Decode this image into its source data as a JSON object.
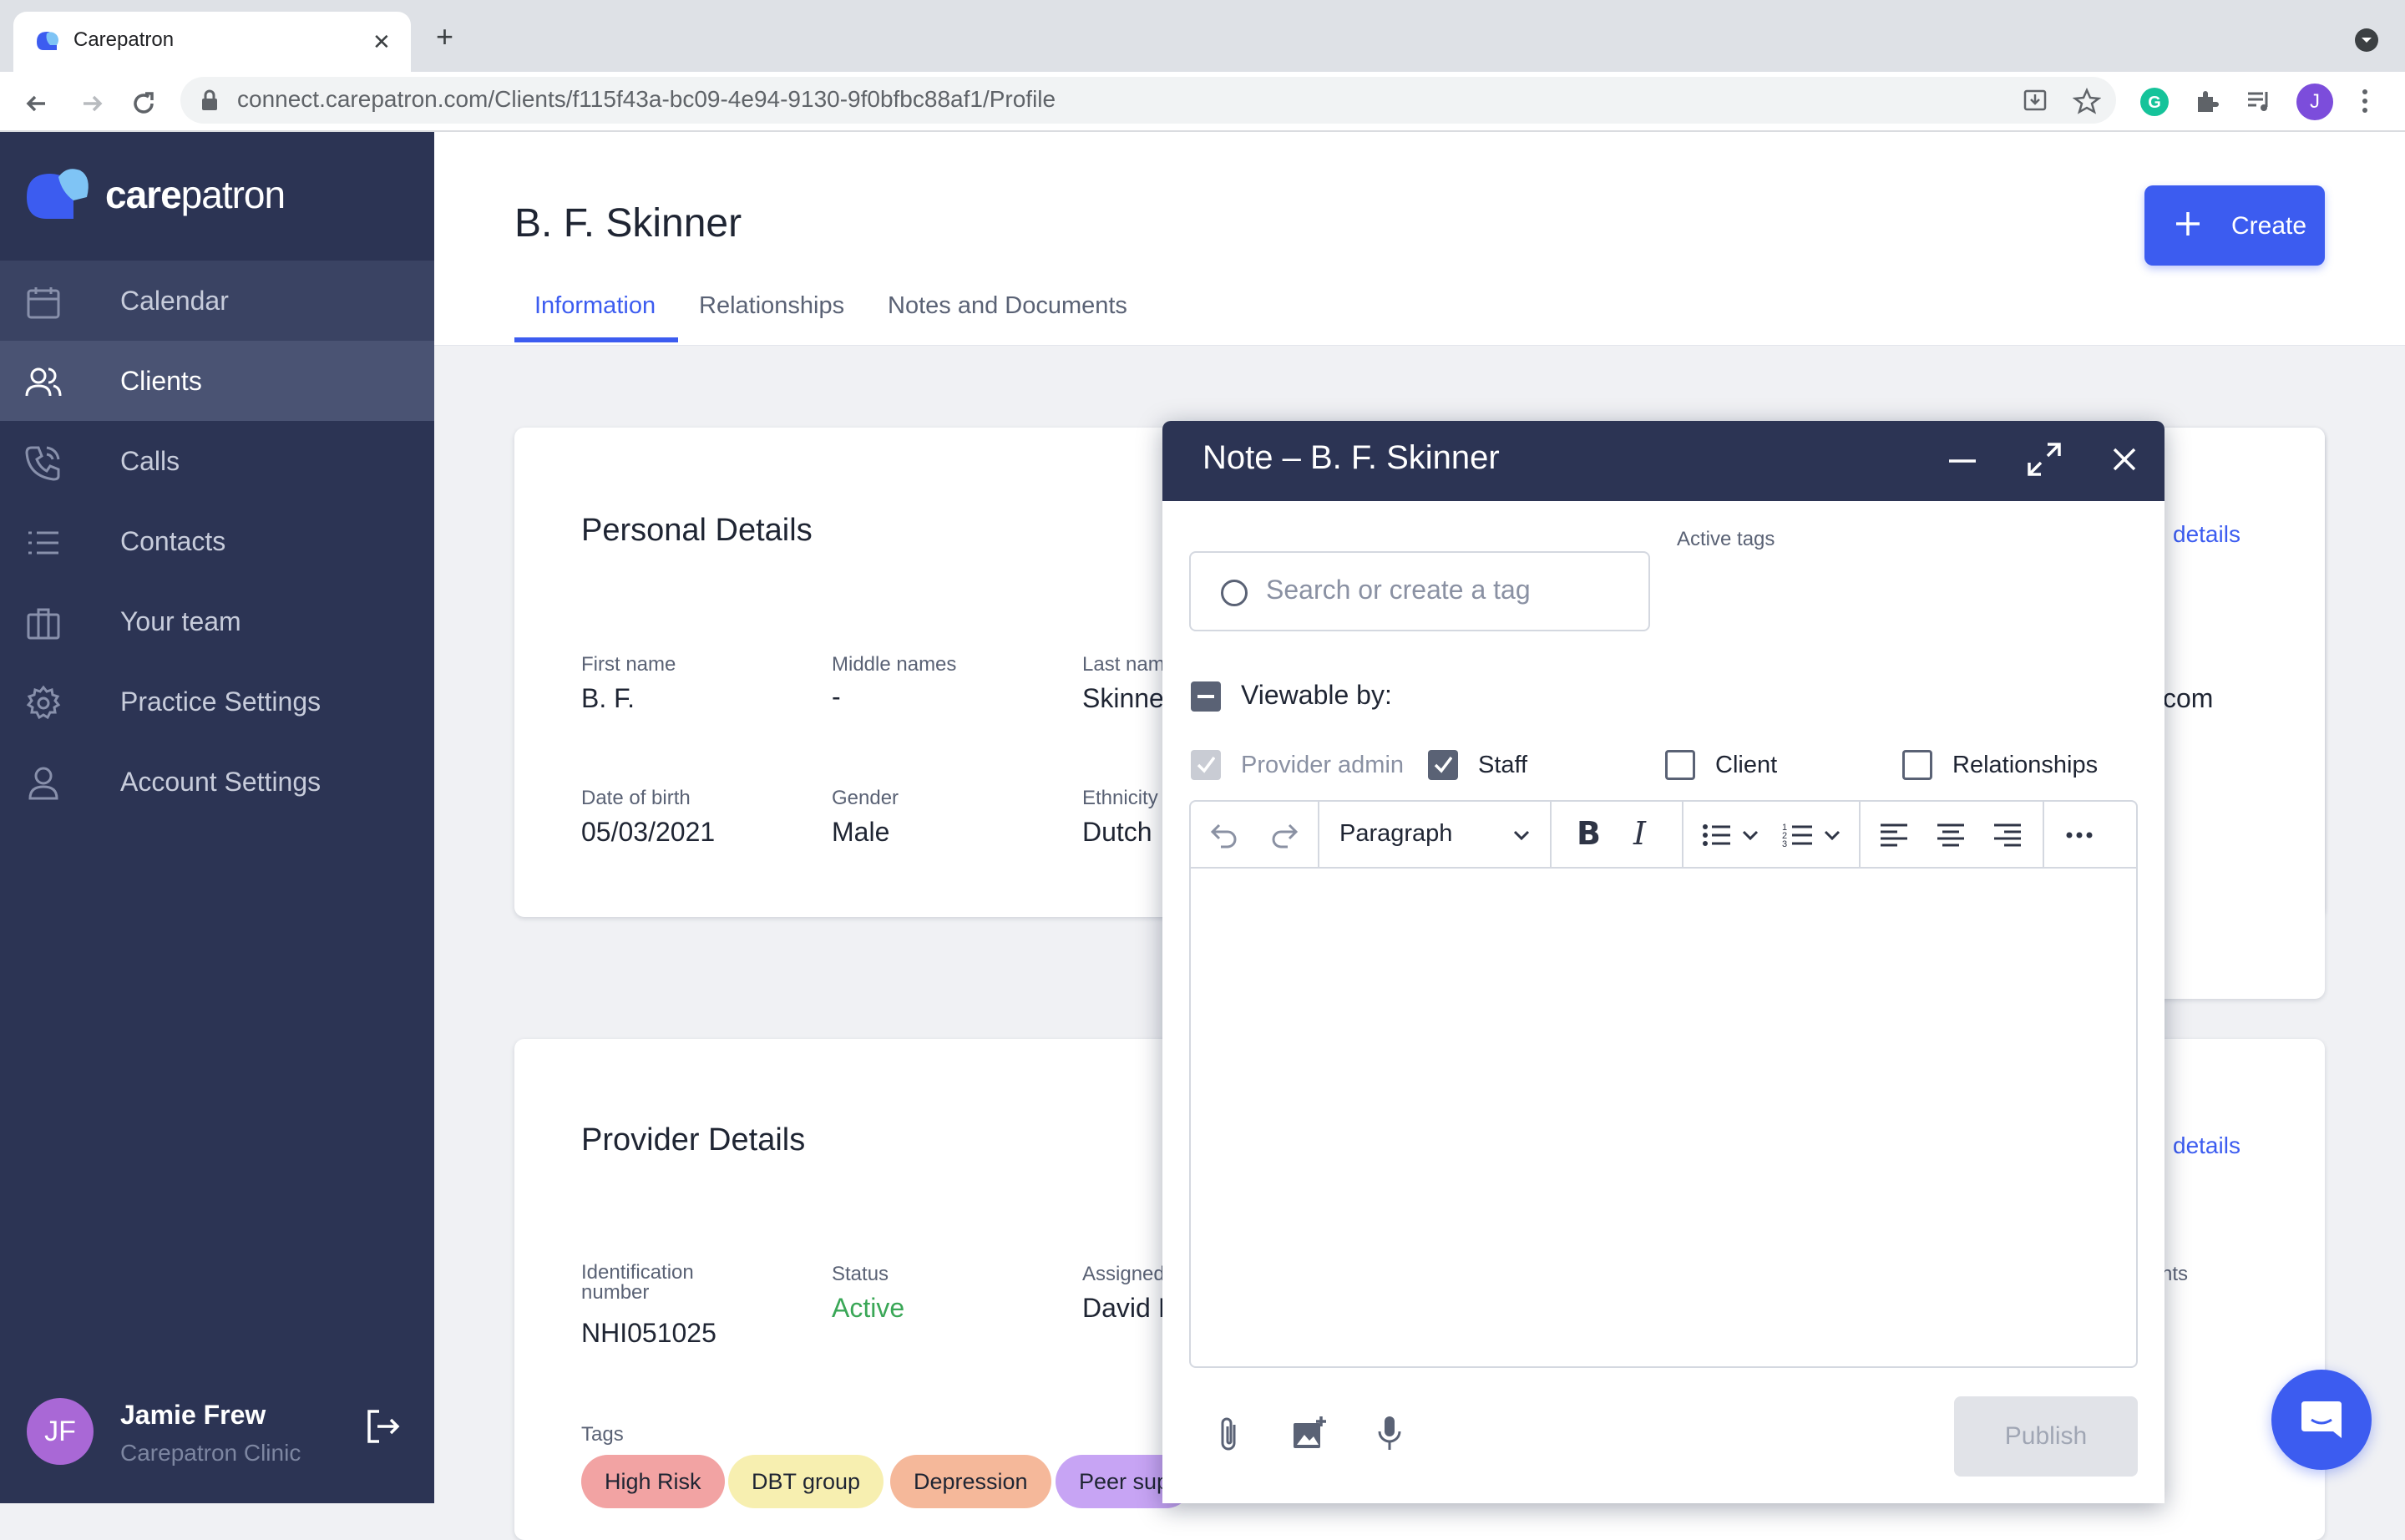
{
  "browser": {
    "tab_title": "Carepatron",
    "tab_close": "✕",
    "new_tab": "+",
    "url": "connect.carepatron.com/Clients/f115f43a-bc09-4e94-9130-9f0bfbc88af1/Profile",
    "profile_initial": "J"
  },
  "sidebar": {
    "logo_text_bold": "care",
    "logo_text_rest": "patron",
    "items": [
      {
        "label": "Calendar",
        "icon": "calendar-icon"
      },
      {
        "label": "Clients",
        "icon": "users-icon"
      },
      {
        "label": "Calls",
        "icon": "phone-icon"
      },
      {
        "label": "Contacts",
        "icon": "list-icon"
      },
      {
        "label": "Your team",
        "icon": "briefcase-icon"
      },
      {
        "label": "Practice Settings",
        "icon": "gear-icon"
      },
      {
        "label": "Account Settings",
        "icon": "person-icon"
      }
    ],
    "user": {
      "initials": "JF",
      "name": "Jamie Frew",
      "org": "Carepatron Clinic"
    }
  },
  "header": {
    "title": "B. F. Skinner",
    "create_label": "Create",
    "tabs": [
      "Information",
      "Relationships",
      "Notes and Documents"
    ],
    "active_tab": "Information"
  },
  "personal": {
    "title": "Personal Details",
    "edit_link": "details",
    "first_name_label": "First name",
    "first_name": "B. F.",
    "middle_names_label": "Middle names",
    "middle_names": "-",
    "last_name_label": "Last nam",
    "last_name": "Skinne",
    "email_fragment": "com",
    "dob_label": "Date of birth",
    "dob": "05/03/2021",
    "gender_label": "Gender",
    "gender": "Male",
    "ethnicity_label": "Ethnicity",
    "ethnicity": "Dutch"
  },
  "provider": {
    "title": "Provider Details",
    "edit_link": "details",
    "id_label": "Identification number",
    "id": "NHI051025",
    "status_label": "Status",
    "status": "Active",
    "assigned_label": "Assigned",
    "assigned": "David I",
    "right_label_fragment": "nts",
    "tags_label": "Tags",
    "tags": [
      {
        "label": "High Risk",
        "color": "#f2a3a3"
      },
      {
        "label": "DBT group",
        "color": "#f7efb0"
      },
      {
        "label": "Depression",
        "color": "#f5b89a"
      },
      {
        "label": "Peer sup",
        "color": "#c7a4f4"
      }
    ]
  },
  "note": {
    "title": "Note – B. F. Skinner",
    "tag_search_placeholder": "Search or create a tag",
    "active_tags_label": "Active tags",
    "viewable_by_label": "Viewable by:",
    "viewers": [
      {
        "label": "Provider admin",
        "state": "checked-disabled"
      },
      {
        "label": "Staff",
        "state": "checked"
      },
      {
        "label": "Client",
        "state": "unchecked"
      },
      {
        "label": "Relationships",
        "state": "unchecked"
      }
    ],
    "paragraph_select": "Paragraph",
    "bold": "B",
    "italic": "I",
    "publish_label": "Publish"
  },
  "colors": {
    "sidebar_bg": "#2c3454",
    "accent": "#3c5cf0",
    "status_active": "#3aa757"
  }
}
